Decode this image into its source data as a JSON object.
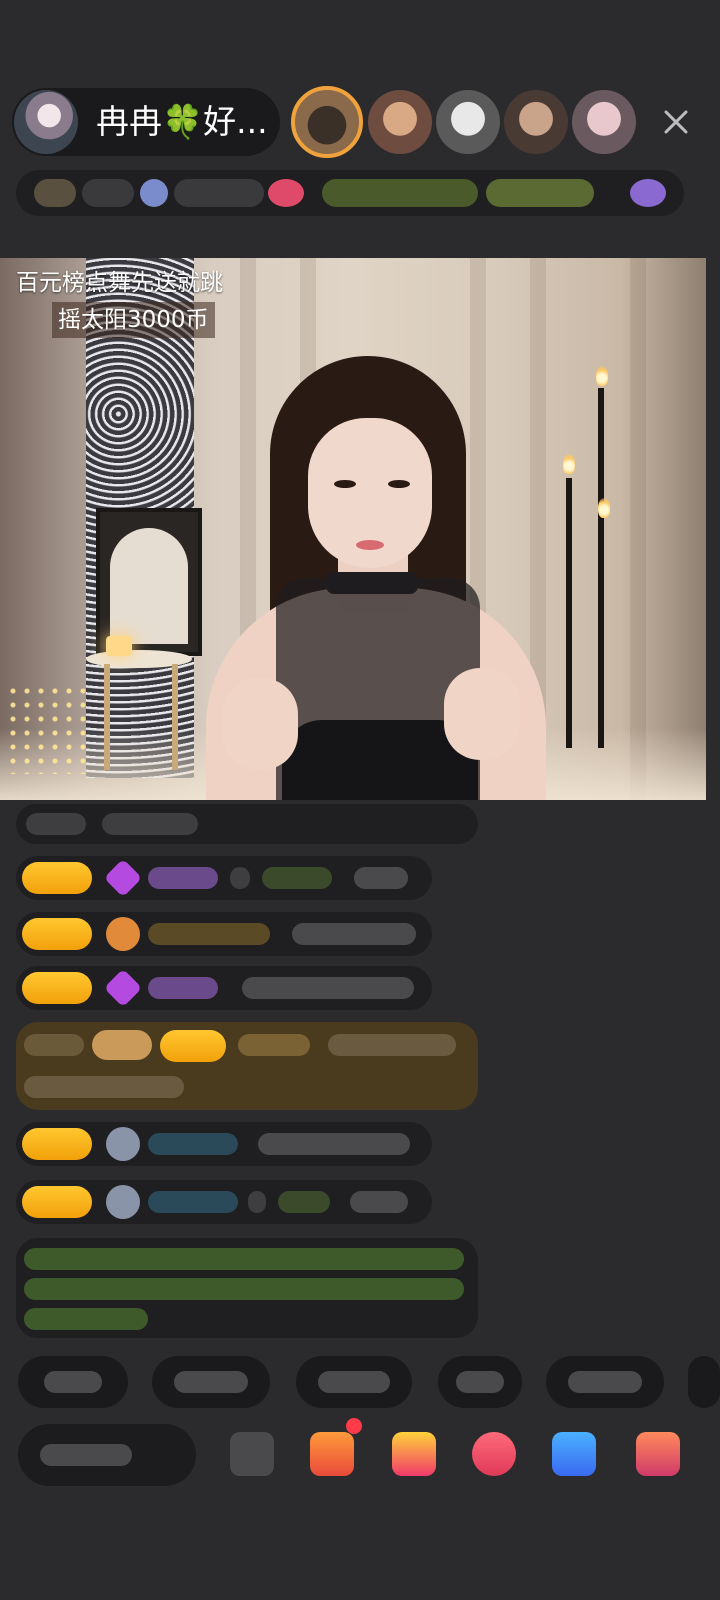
{
  "host": {
    "name": "冉冉🍀好..."
  },
  "header": {
    "close_icon": "close-icon",
    "viewer_avatar_count": 5
  },
  "video": {
    "overlay_line1": "百元榜点舞先送就跳",
    "overlay_line2": "摇太阳3000币"
  },
  "colors": {
    "background": "#2b2b2d",
    "badge_gold": "#f2a10a",
    "highlight_message": "#4a3a1e",
    "purple_gem": "#b44ae0",
    "cyan_name": "#3aa6c8",
    "green_text": "#8fc34a"
  },
  "chat": {
    "message_count": 10,
    "highlighted_index": 4
  }
}
